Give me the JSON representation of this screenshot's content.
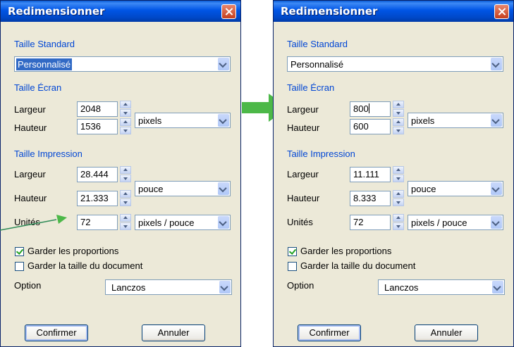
{
  "left_dialog": {
    "title": "Redimensionner",
    "standard_size": {
      "label": "Taille Standard",
      "selected": "Personnalisé"
    },
    "screen_size": {
      "label": "Taille Écran",
      "width_label": "Largeur",
      "width": "2048",
      "height_label": "Hauteur",
      "height": "1536",
      "unit": "pixels"
    },
    "print_size": {
      "label": "Taille Impression",
      "width_label": "Largeur",
      "width": "28.444",
      "height_label": "Hauteur",
      "height": "21.333",
      "unit": "pouce",
      "units_label": "Unités",
      "units": "72",
      "units_unit": "pixels / pouce"
    },
    "keep_proportions": {
      "label": "Garder les proportions",
      "checked": true
    },
    "keep_doc_size": {
      "label": "Garder la taille du document",
      "checked": false
    },
    "option": {
      "label": "Option",
      "selected": "Lanczos"
    },
    "confirm_label": "Confirmer",
    "cancel_label": "Annuler"
  },
  "right_dialog": {
    "title": "Redimensionner",
    "standard_size": {
      "label": "Taille Standard",
      "selected": "Personnalisé"
    },
    "screen_size": {
      "label": "Taille Écran",
      "width_label": "Largeur",
      "width": "800",
      "height_label": "Hauteur",
      "height": "600",
      "unit": "pixels"
    },
    "print_size": {
      "label": "Taille Impression",
      "width_label": "Largeur",
      "width": "11.111",
      "height_label": "Hauteur",
      "height": "8.333",
      "unit": "pouce",
      "units_label": "Unités",
      "units": "72",
      "units_unit": "pixels / pouce"
    },
    "keep_proportions": {
      "label": "Garder les proportions",
      "checked": true
    },
    "keep_doc_size": {
      "label": "Garder la taille du document",
      "checked": false
    },
    "option": {
      "label": "Option",
      "selected": "Lanczos"
    },
    "confirm_label": "Confirmer",
    "cancel_label": "Annuler"
  },
  "colors": {
    "arrow": "#4cb848",
    "titlebar": "#0055e5",
    "group_label": "#0046d5",
    "highlight": "#316ac5"
  }
}
